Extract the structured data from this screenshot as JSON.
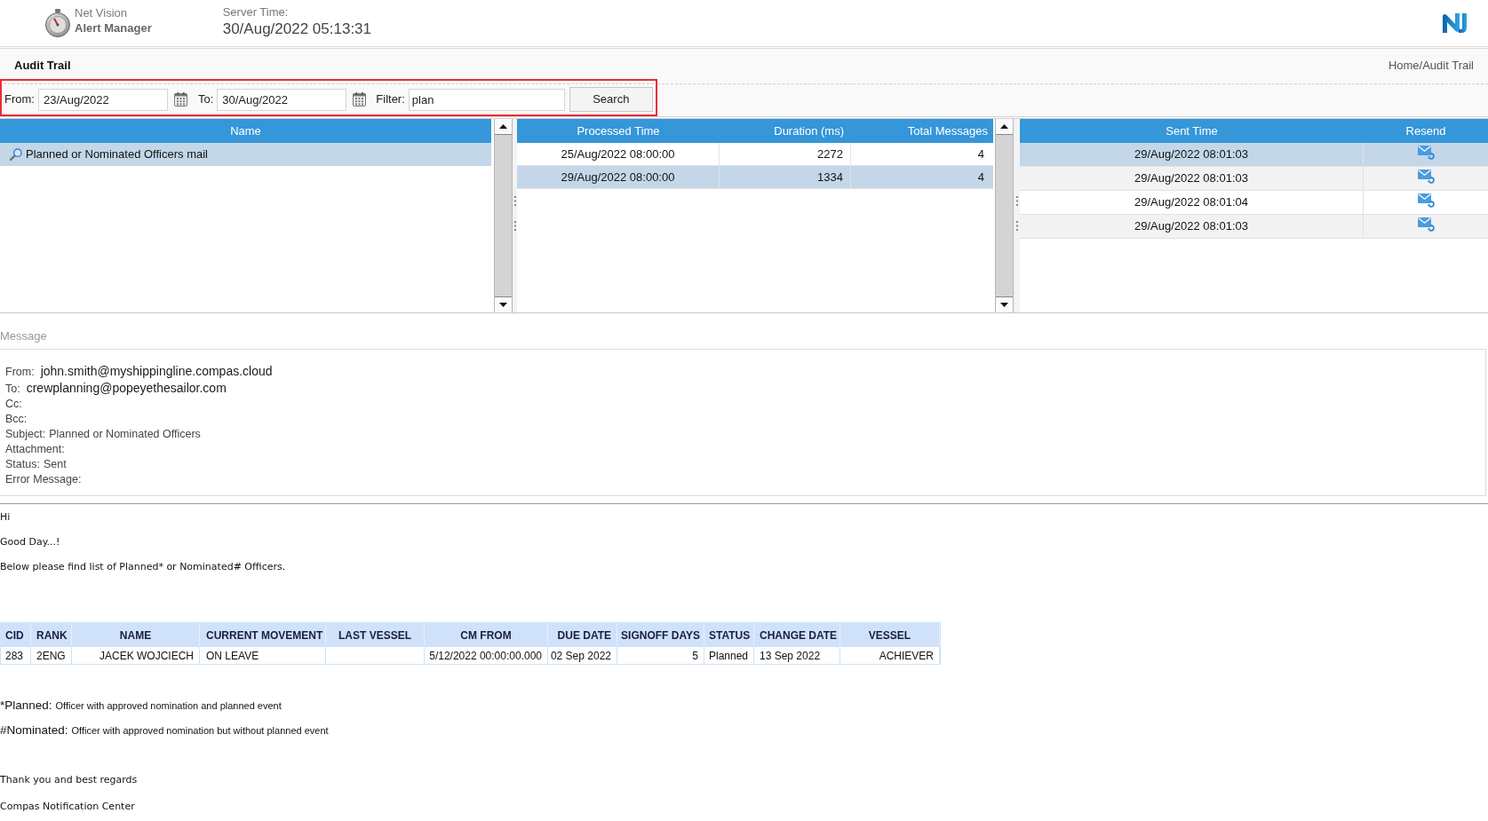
{
  "header": {
    "app_name": "Net Vision",
    "app_subtitle": "Alert Manager",
    "server_time_label": "Server Time:",
    "server_time": "30/Aug/2022 05:13:31"
  },
  "page": {
    "title": "Audit Trail",
    "breadcrumb": "Home/Audit Trail"
  },
  "filter": {
    "from": {
      "label": "From:",
      "value": "23/Aug/2022"
    },
    "to": {
      "label": "To:",
      "value": "30/Aug/2022"
    },
    "filter": {
      "label": "Filter:",
      "value": "plan"
    },
    "search_button": "Search"
  },
  "alerts_grid": {
    "columns": [
      "Name"
    ],
    "rows": [
      {
        "name": "Planned or Nominated Officers mail",
        "selected": true
      }
    ]
  },
  "runs_grid": {
    "columns": [
      "Processed Time",
      "Duration (ms)",
      "Total Messages"
    ],
    "rows": [
      {
        "processed_time": "25/Aug/2022 08:00:00",
        "duration": "2272",
        "total_messages": "4",
        "selected": false
      },
      {
        "processed_time": "29/Aug/2022 08:00:00",
        "duration": "1334",
        "total_messages": "4",
        "selected": true
      }
    ]
  },
  "messages_grid": {
    "columns": [
      "Sent Time",
      "Resend"
    ],
    "rows": [
      {
        "sent_time": "29/Aug/2022 08:01:03",
        "selected": true
      },
      {
        "sent_time": "29/Aug/2022 08:01:03",
        "selected": false
      },
      {
        "sent_time": "29/Aug/2022 08:01:04",
        "selected": false
      },
      {
        "sent_time": "29/Aug/2022 08:01:03",
        "selected": false
      }
    ]
  },
  "message": {
    "label": "Message",
    "fields": [
      {
        "label": "From:",
        "value": "john.smith@myshippingline.compas.cloud",
        "kind": "address"
      },
      {
        "label": "To:",
        "value": "crewplanning@popeyethesailor.com",
        "kind": "address"
      },
      {
        "label": "Cc:"
      },
      {
        "label": "Bcc:"
      },
      {
        "label": "Subject:",
        "value": "Planned or Nominated Officers",
        "kind": "text"
      },
      {
        "label": "Attachment:"
      },
      {
        "label": "Status:",
        "value": "Sent",
        "kind": "text"
      },
      {
        "label": "Error Message:"
      }
    ]
  },
  "email_body": {
    "paragraphs": [
      "Hi",
      "Good Day...!",
      "Below please find list of Planned* or Nominated# Officers."
    ],
    "table": {
      "columns": [
        "CID",
        "RANK",
        "NAME",
        "CURRENT MOVEMENT",
        "LAST VESSEL",
        "CM FROM",
        "DUE DATE",
        "SIGNOFF DAYS",
        "STATUS",
        "CHANGE DATE",
        "VESSEL"
      ],
      "rows": [
        {
          "cid": "283",
          "rank": "2ENG",
          "name": "JACEK WOJCIECH",
          "current_movement": "ON LEAVE",
          "cm_from": "5/12/2022 00:00:00.000",
          "due_date": "02 Sep 2022",
          "signoff_days": "5",
          "status": "Planned",
          "change_date": "13 Sep 2022",
          "vessel": "ACHIEVER"
        }
      ]
    },
    "notes": [
      {
        "term": "*Planned:",
        "text": "Officer with approved nomination and planned event"
      },
      {
        "term": "#Nominated:",
        "text": "Officer with approved nomination but without planned event"
      }
    ],
    "closing": [
      "Thank you and best regards",
      "Compas Notification Center"
    ]
  }
}
